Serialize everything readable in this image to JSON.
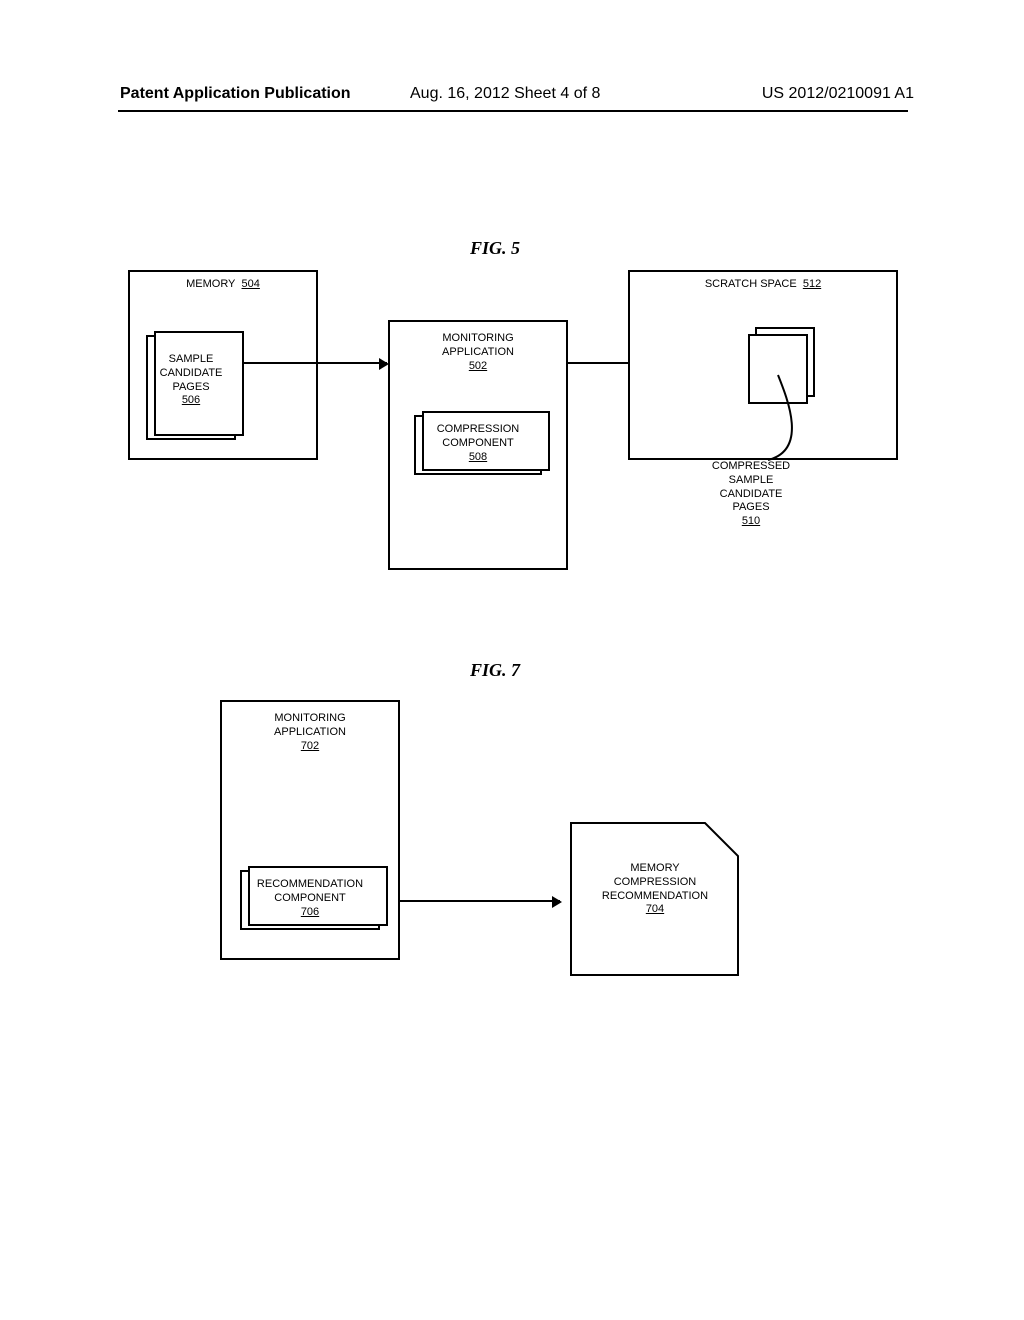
{
  "header": {
    "left": "Patent Application Publication",
    "date": "Aug. 16, 2012  Sheet 4 of 8",
    "right": "US 2012/0210091 A1"
  },
  "fig5": {
    "caption": "FIG. 5",
    "memory_box": {
      "title": "MEMORY",
      "ref": "504"
    },
    "sample_pages": {
      "l1": "SAMPLE",
      "l2": "CANDIDATE",
      "l3": "PAGES",
      "ref": "506"
    },
    "monitoring_app": {
      "l1": "MONITORING",
      "l2": "APPLICATION",
      "ref": "502"
    },
    "compression_comp": {
      "l1": "COMPRESSION",
      "l2": "COMPONENT",
      "ref": "508"
    },
    "scratch_space": {
      "title": "SCRATCH SPACE",
      "ref": "512"
    },
    "compressed_pages": {
      "l1": "COMPRESSED",
      "l2": "SAMPLE",
      "l3": "CANDIDATE",
      "l4": "PAGES",
      "ref": "510"
    }
  },
  "fig7": {
    "caption": "FIG. 7",
    "monitoring_app": {
      "l1": "MONITORING",
      "l2": "APPLICATION",
      "ref": "702"
    },
    "recommendation_comp": {
      "l1": "RECOMMENDATION",
      "l2": "COMPONENT",
      "ref": "706"
    },
    "doc": {
      "l1": "MEMORY",
      "l2": "COMPRESSION",
      "l3": "RECOMMENDATION",
      "ref": "704"
    }
  }
}
